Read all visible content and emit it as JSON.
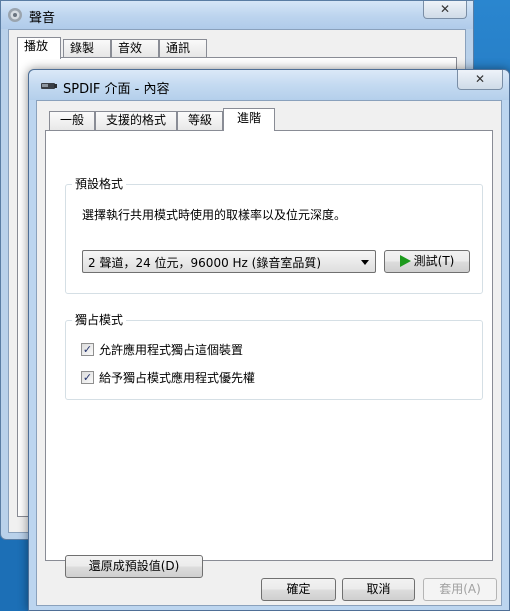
{
  "background_window": {
    "title": "聲音",
    "icon": "speaker-icon",
    "close_glyph": "✕",
    "tabs": [
      {
        "label": "播放",
        "selected": true
      },
      {
        "label": "錄製",
        "selected": false
      },
      {
        "label": "音效",
        "selected": false
      },
      {
        "label": "通訊",
        "selected": false
      }
    ]
  },
  "dialog": {
    "title": "SPDIF 介面 - 內容",
    "icon": "spdif-device-icon",
    "close_glyph": "✕",
    "tabs": [
      {
        "label": "一般",
        "selected": false
      },
      {
        "label": "支援的格式",
        "selected": false
      },
      {
        "label": "等級",
        "selected": false
      },
      {
        "label": "進階",
        "selected": true
      }
    ],
    "default_format": {
      "group_label": "預設格式",
      "description": "選擇執行共用模式時使用的取樣率以及位元深度。",
      "selected_format": "2 聲道，24 位元，96000 Hz (錄音室品質)",
      "test_button": "測試(T)"
    },
    "exclusive_mode": {
      "group_label": "獨占模式",
      "options": [
        {
          "label": "允許應用程式獨占這個裝置",
          "checked": true
        },
        {
          "label": "給予獨占模式應用程式優先權",
          "checked": true
        }
      ]
    },
    "restore_defaults_button": "還原成預設值(D)",
    "footer": {
      "ok": "確定",
      "cancel": "取消",
      "apply": "套用(A)",
      "apply_enabled": false
    }
  }
}
